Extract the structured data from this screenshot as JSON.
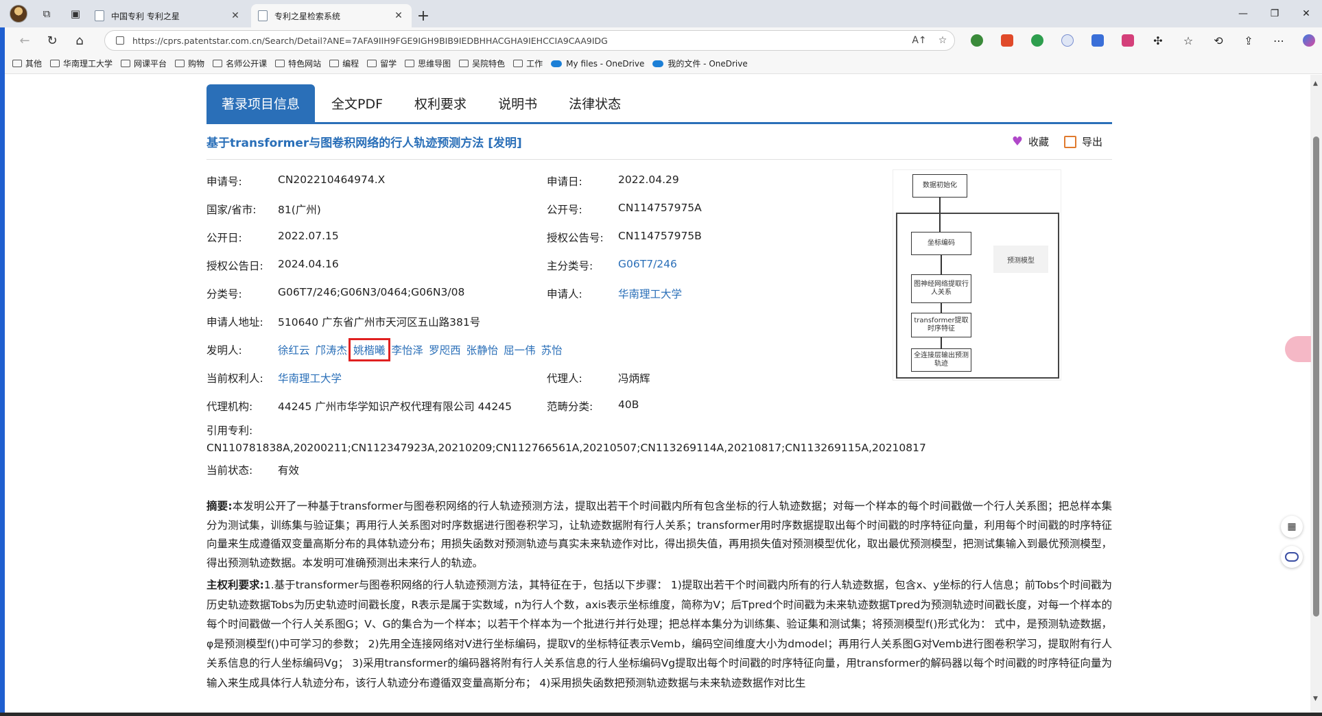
{
  "browser": {
    "tabs": [
      {
        "title": "中国专利 专利之星",
        "active": false
      },
      {
        "title": "专利之星检索系统",
        "active": true
      }
    ],
    "url": "https://cprs.patentstar.com.cn/Search/Detail?ANE=7AFA9IIH9FGE9IGH9BIB9IEDBHHACGHA9IEHCCIA9CAA9IDG",
    "bookmarks": [
      "其他",
      "华南理工大学",
      "网课平台",
      "购物",
      "名师公开课",
      "特色网站",
      "编程",
      "留学",
      "思维导图",
      "吴院特色",
      "工作",
      "My files - OneDrive",
      "我的文件 - OneDrive"
    ]
  },
  "page_tabs": [
    "著录项目信息",
    "全文PDF",
    "权利要求",
    "说明书",
    "法律状态"
  ],
  "patent": {
    "title": "基于transformer与图卷积网络的行人轨迹预测方法 [发明]",
    "favorite_label": "收藏",
    "export_label": "导出",
    "fields": {
      "app_no_label": "申请号:",
      "app_no": "CN202210464974.X",
      "app_date_label": "申请日:",
      "app_date": "2022.04.29",
      "country_label": "国家/省市:",
      "country": "81(广州)",
      "pub_no_label": "公开号:",
      "pub_no": "CN114757975A",
      "pub_date_label": "公开日:",
      "pub_date": "2022.07.15",
      "grant_no_label": "授权公告号:",
      "grant_no": "CN114757975B",
      "grant_date_label": "授权公告日:",
      "grant_date": "2024.04.16",
      "main_class_label": "主分类号:",
      "main_class": "G06T7/246",
      "class_label": "分类号:",
      "class": "G06T7/246;G06N3/0464;G06N3/08",
      "applicant_label": "申请人:",
      "applicant": "华南理工大学",
      "address_label": "申请人地址:",
      "address": "510640 广东省广州市天河区五山路381号",
      "inventor_label": "发明人:",
      "inventors": [
        "徐红云",
        "邝涛杰",
        "姚楷曦",
        "李怡泽",
        "罗咫西",
        "张静怡",
        "屈一伟",
        "苏怡"
      ],
      "owner_label": "当前权利人:",
      "owner": "华南理工大学",
      "agent_label": "代理人:",
      "agent": "冯炳辉",
      "agency_label": "代理机构:",
      "agency": "44245 广州市华学知识产权代理有限公司 44245",
      "category_label": "范畴分类:",
      "category": "40B",
      "cited_label": "引用专利:",
      "cited": "CN110781838A,20200211;CN112347923A,20210209;CN112766561A,20210507;CN113269114A,20210817;CN113269115A,20210817",
      "status_label": "当前状态:",
      "status": "有效"
    },
    "figure": {
      "step1": "数据初始化",
      "step2": "坐标编码",
      "step3": "图神经网络提取行人关系",
      "step4": "transformer提取时序特征",
      "step5": "全连接层输出预测轨迹",
      "side": "预测模型"
    },
    "abstract_label": "摘要:",
    "abstract": "本发明公开了一种基于transformer与图卷积网络的行人轨迹预测方法，提取出若干个时间戳内所有包含坐标的行人轨迹数据；对每一个样本的每个时间戳做一个行人关系图；把总样本集分为测试集，训练集与验证集；再用行人关系图对时序数据进行图卷积学习，让轨迹数据附有行人关系；transformer用时序数据提取出每个时间戳的时序特征向量，利用每个时间戳的时序特征向量来生成遵循双变量高斯分布的具体轨迹分布；用损失函数对预测轨迹与真实未来轨迹作对比，得出损失值，再用损失值对预测模型优化，取出最优预测模型，把测试集输入到最优预测模型，得出预测轨迹数据。本发明可准确预测出未来行人的轨迹。",
    "claims_label": "主权利要求:",
    "claims": "1.基于transformer与图卷积网络的行人轨迹预测方法，其特征在于，包括以下步骤： 1)提取出若干个时间戳内所有的行人轨迹数据，包含x、y坐标的行人信息；前Tobs个时间戳为历史轨迹数据Tobs为历史轨迹时间戳长度，R表示是属于实数域，n为行人个数，axis表示坐标维度，简称为V；后Tpred个时间戳为未来轨迹数据Tpred为预测轨迹时间戳长度，对每一个样本的每个时间戳做一个行人关系图G；V、G的集合为一个样本；以若干个样本为一个批进行并行处理；把总样本集分为训练集、验证集和测试集；将预测模型f()形式化为： 式中，是预测轨迹数据，φ是预测模型f()中可学习的参数； 2)先用全连接网络对V进行坐标编码，提取V的坐标特征表示Vemb，编码空间维度大小为dmodel；再用行人关系图G对Vemb进行图卷积学习，提取附有行人关系信息的行人坐标编码Vg； 3)采用transformer的编码器将附有行人关系信息的行人坐标编码Vg提取出每个时间戳的时序特征向量，用transformer的解码器以每个时间戳的时序特征向量为输入来生成具体行人轨迹分布，该行人轨迹分布遵循双变量高斯分布； 4)采用损失函数把预测轨迹数据与未来轨迹数据作对比生"
  },
  "colors": {
    "accent": "#2a6fb8",
    "highlight_box": "#e02020"
  }
}
